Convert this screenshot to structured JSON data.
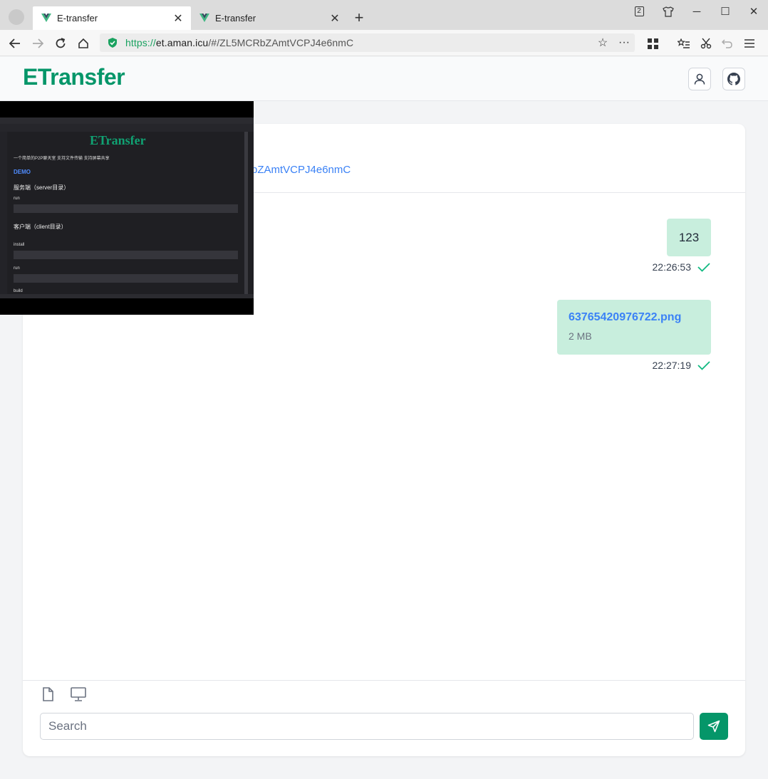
{
  "browser": {
    "tabs": [
      {
        "title": "E-transfer",
        "active": true
      },
      {
        "title": "E-transfer",
        "active": false
      }
    ],
    "tab_count": "2",
    "url": {
      "scheme": "https://",
      "host": "et.aman.icu",
      "path": "/#/ZL5MCRbZAmtVCPJ4e6nmC"
    }
  },
  "app": {
    "logo": "ETransfer",
    "brand_color": "#059669"
  },
  "room": {
    "link_visible": "bZAmtVCPJ4e6nmC"
  },
  "messages": [
    {
      "type": "text",
      "content": "123",
      "time": "22:26:53",
      "status": "sent"
    },
    {
      "type": "file",
      "name": "63765420976722.png",
      "size": "2 MB",
      "time": "22:27:19",
      "status": "sent"
    }
  ],
  "composer": {
    "placeholder": "Search"
  },
  "video_overlay": {
    "logo": "ETransfer",
    "subtitle": "一个简单的P2P聊天室 支持文件传输 支持屏幕共享",
    "demo": "DEMO",
    "server_heading": "服务端（server目录）",
    "server_run": "run",
    "client_heading": "客户端（client目录）",
    "client_install": "install",
    "client_run": "run",
    "client_build": "build"
  }
}
